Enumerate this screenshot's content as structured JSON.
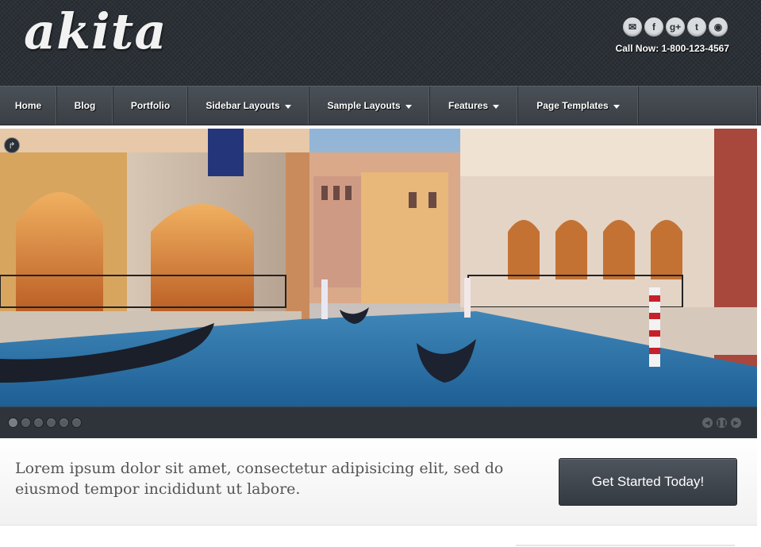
{
  "header": {
    "logo": "akita",
    "call_now": "Call Now: 1-800-123-4567",
    "social": [
      {
        "name": "email-icon",
        "glyph": "✉"
      },
      {
        "name": "facebook-icon",
        "glyph": "f"
      },
      {
        "name": "google-plus-icon",
        "glyph": "g+"
      },
      {
        "name": "twitter-icon",
        "glyph": "t"
      },
      {
        "name": "rss-icon",
        "glyph": "◉"
      }
    ]
  },
  "nav": {
    "items": [
      {
        "label": "Home",
        "dropdown": false
      },
      {
        "label": "Blog",
        "dropdown": false
      },
      {
        "label": "Portfolio",
        "dropdown": false
      },
      {
        "label": "Sidebar Layouts",
        "dropdown": true
      },
      {
        "label": "Sample Layouts",
        "dropdown": true
      },
      {
        "label": "Features",
        "dropdown": true
      },
      {
        "label": "Page Templates",
        "dropdown": true
      }
    ]
  },
  "slider": {
    "slide_count": 6,
    "active_index": 0,
    "controls": [
      "prev-icon",
      "pause-icon",
      "next-icon"
    ]
  },
  "tagline": {
    "text": "Lorem ipsum dolor sit amet, consectetur adipisicing elit, sed do eiusmod tempor incididunt ut labore.",
    "button_label": "Get Started Today!"
  },
  "colors": {
    "header_bg": "#2b3036",
    "nav_bg": "#42474d",
    "button_bg": "#3f454c"
  }
}
